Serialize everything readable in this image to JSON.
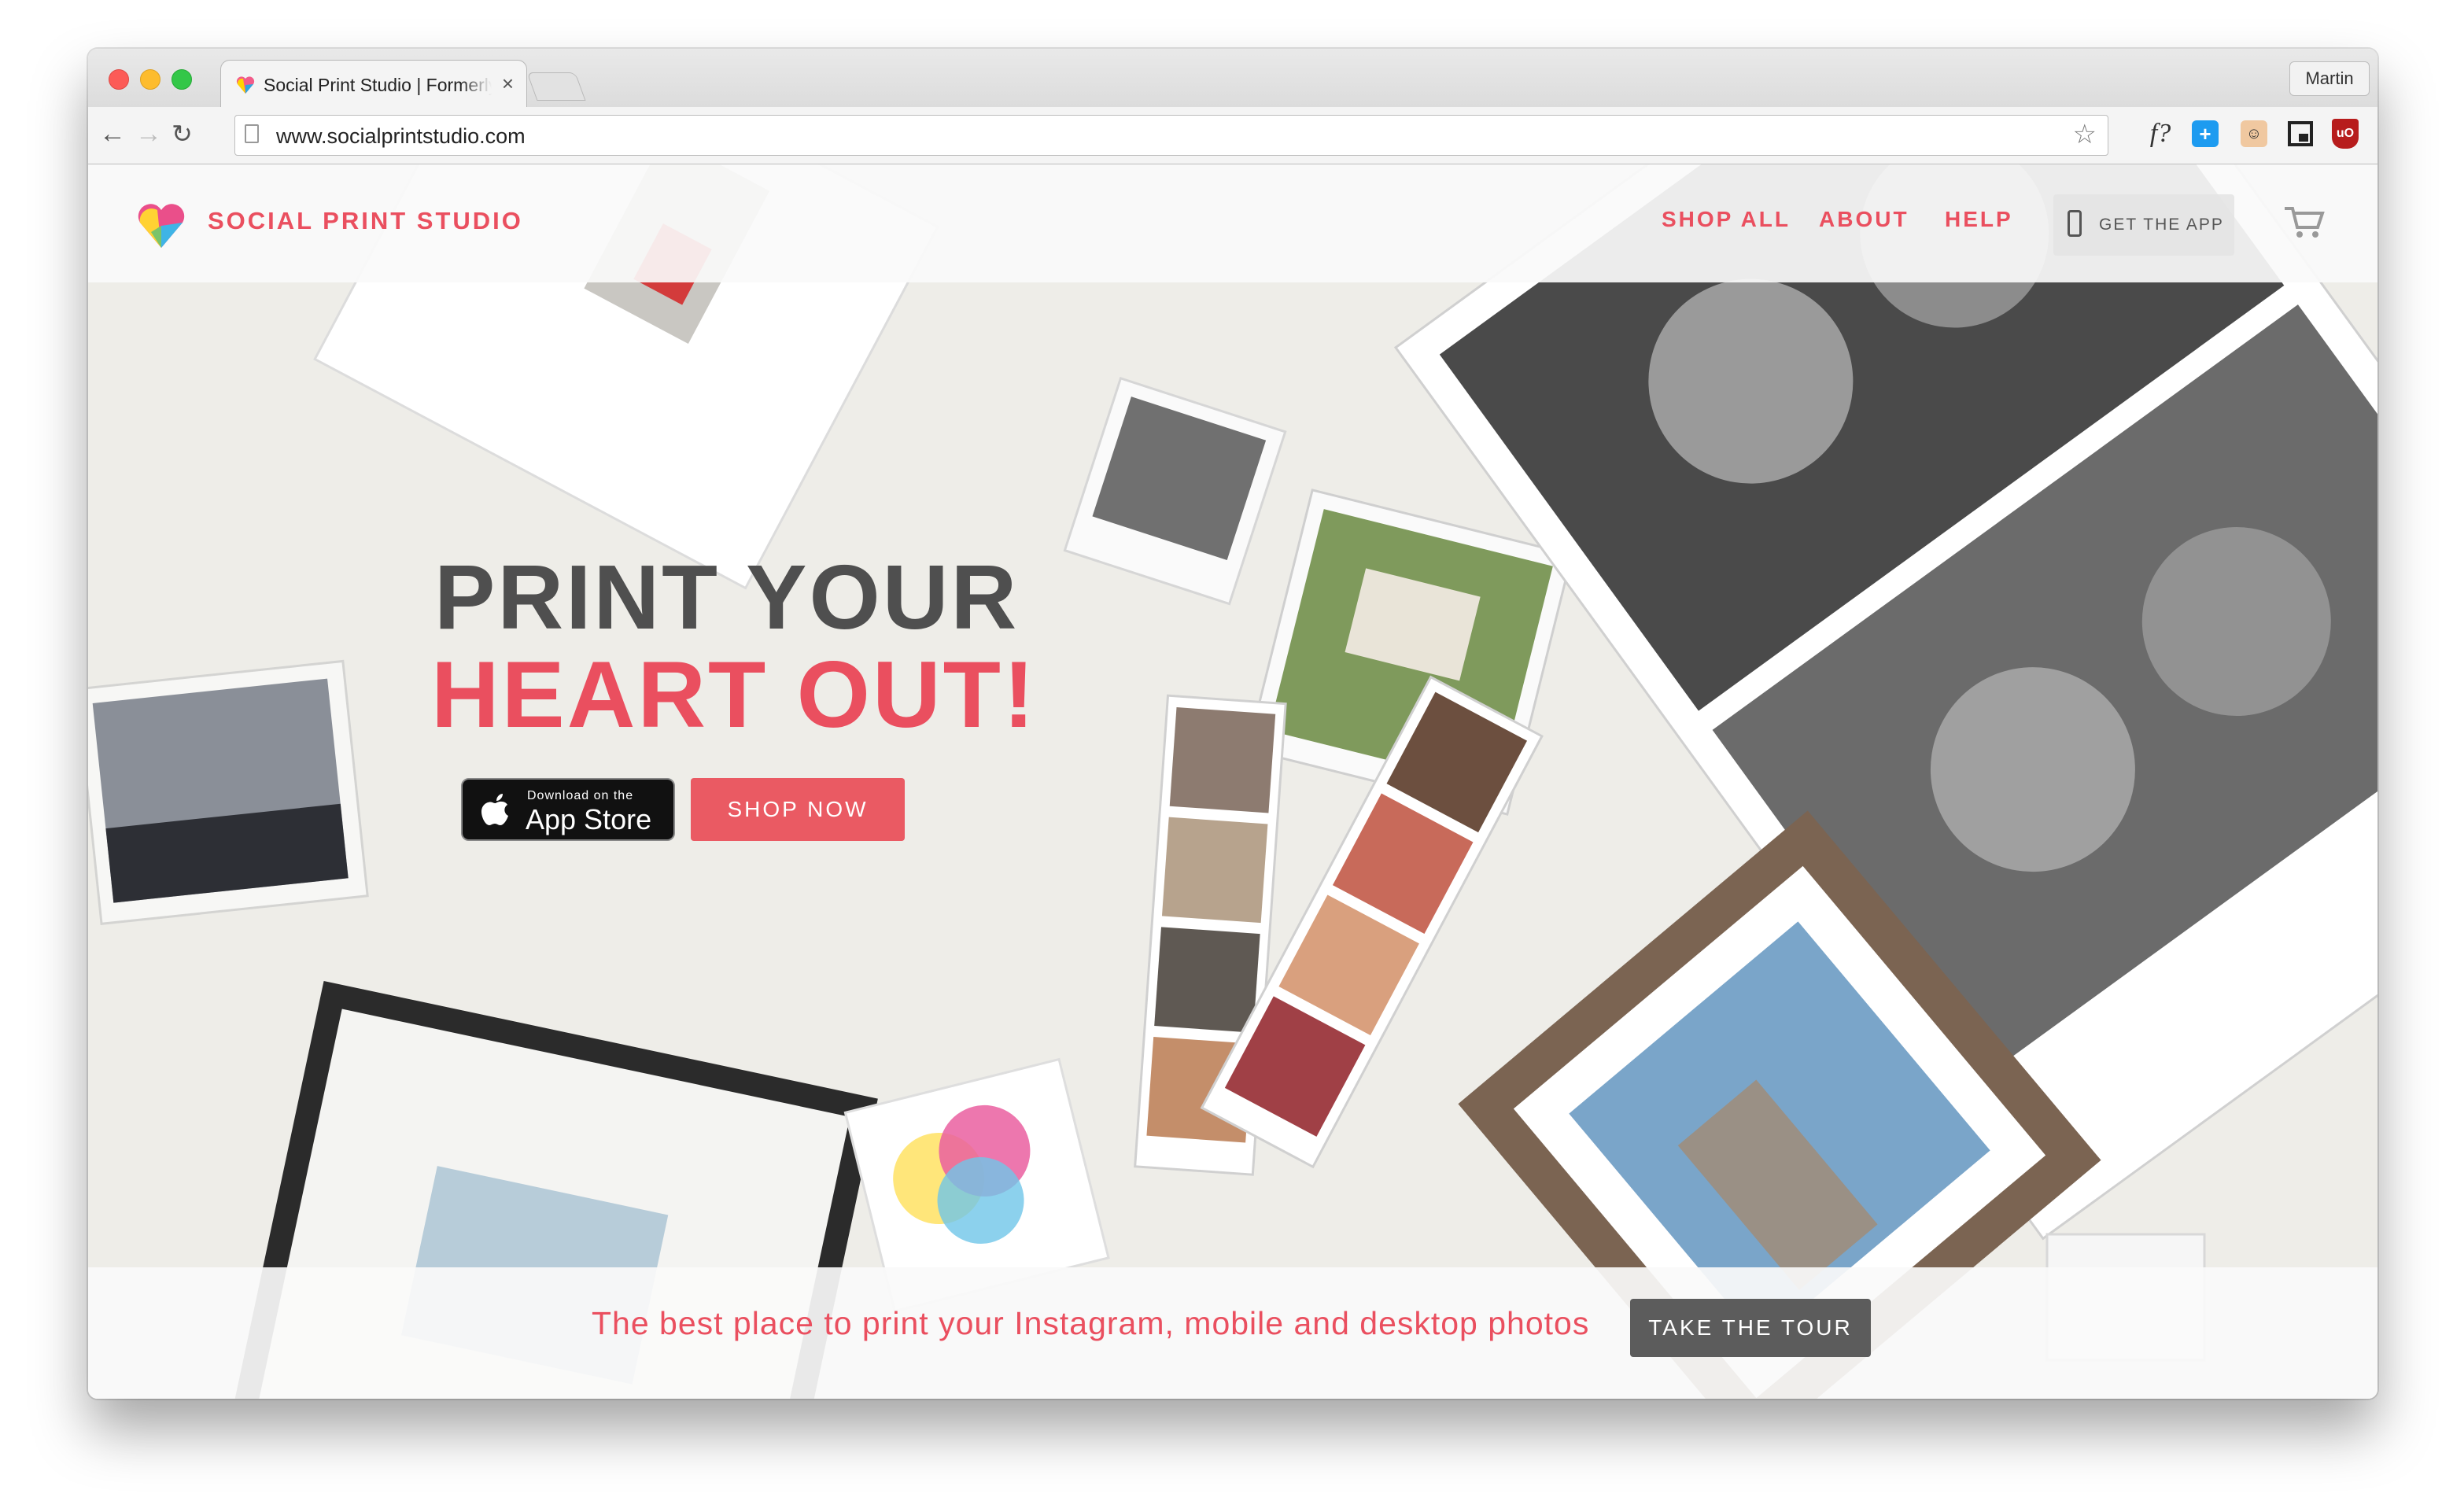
{
  "browser": {
    "tab_title": "Social Print Studio | Formerly Printstagram",
    "tab_close": "×",
    "profile_name": "Martin",
    "url": "www.socialprintstudio.com",
    "nav_back": "←",
    "nav_forward": "→",
    "nav_reload": "↻",
    "star": "☆",
    "ext_f": "f?",
    "ext_plus": "+",
    "ext_ublock": "uO"
  },
  "site": {
    "brand": "SOCIAL PRINT STUDIO",
    "nav": {
      "shop_all": "SHOP ALL",
      "about": "ABOUT",
      "help": "HELP",
      "get_app": "GET THE APP"
    },
    "hero": {
      "title_line1": "PRINT YOUR",
      "title_line2": "HEART OUT!",
      "appstore_small": "Download on the",
      "appstore_big": "App Store",
      "shop_now": "SHOP NOW"
    },
    "footer_bar": {
      "tagline": "The best place to print your Instagram, mobile and desktop photos",
      "tour_button": "TAKE THE TOUR"
    },
    "colors": {
      "brand_red": "#ea4f5f",
      "dark_gray": "#4f4f4f",
      "button_gray": "#5c5c5c"
    },
    "icons": [
      "logo-heart-icon",
      "phone-icon",
      "cart-icon",
      "apple-icon"
    ]
  }
}
